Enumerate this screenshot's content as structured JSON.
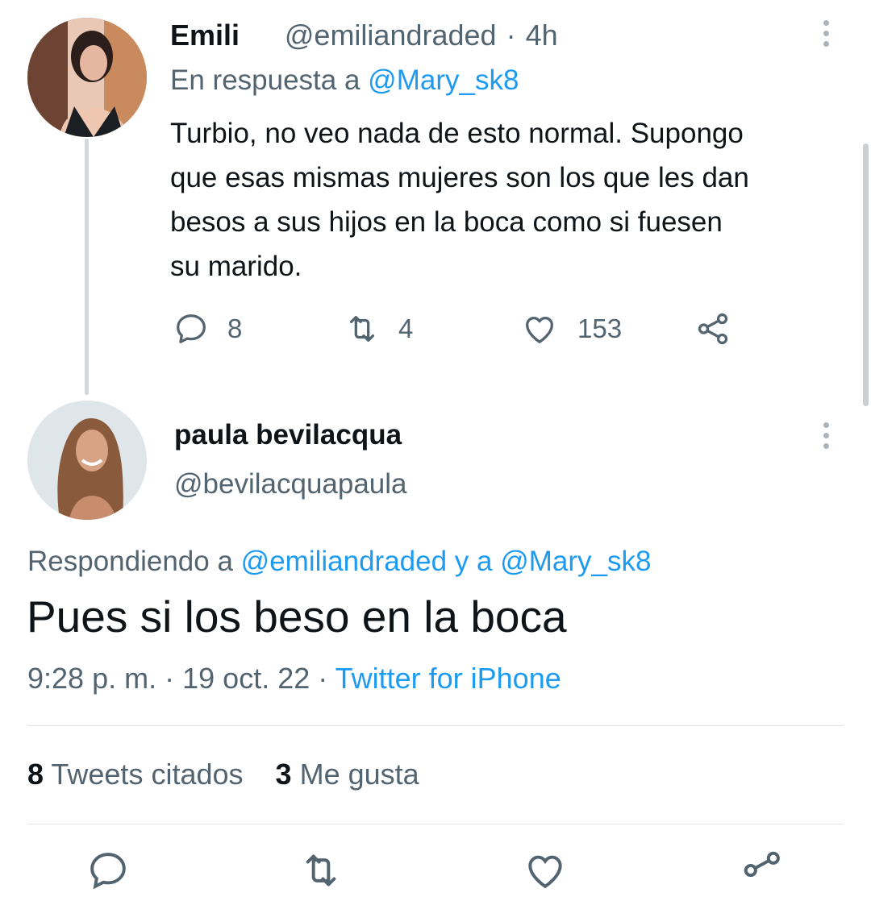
{
  "reply_tweet": {
    "display_name": "Emili",
    "name_emoji": "🤍",
    "handle": "@emiliandraded",
    "separator": "·",
    "time": "4h",
    "reply_prefix": "En respuesta a",
    "reply_to": "@Mary_sk8",
    "text_lines": [
      "Turbio, no veo nada de esto normal. Supongo",
      "que esas mismas mujeres son los que les dan",
      "besos a sus hijos en la boca como si fuesen",
      "su marido."
    ],
    "stats": {
      "replies": "8",
      "retweets": "4",
      "likes": "153"
    },
    "icons": {
      "reply": "reply-icon",
      "retweet": "retweet-icon",
      "like": "heart-icon",
      "share": "share-icon",
      "more": "more-icon"
    }
  },
  "main_tweet": {
    "display_name": "paula bevilacqua",
    "handle": "@bevilacquapaula",
    "replying_prefix": "Respondiendo a",
    "replying_to_1": "@emiliandraded",
    "replying_conj": "y a",
    "replying_to_2": "@Mary_sk8",
    "text": "Pues si los beso en la boca",
    "time": "9:28 p. m.",
    "sep1": "·",
    "date": "19 oct. 22",
    "sep2": "·",
    "source": "Twitter for iPhone",
    "quote_count": "8",
    "quote_label": "Tweets citados",
    "like_count": "3",
    "like_label": "Me gusta"
  },
  "colors": {
    "accent": "#1d9bf0",
    "text": "#0f1419",
    "muted": "#536471"
  }
}
